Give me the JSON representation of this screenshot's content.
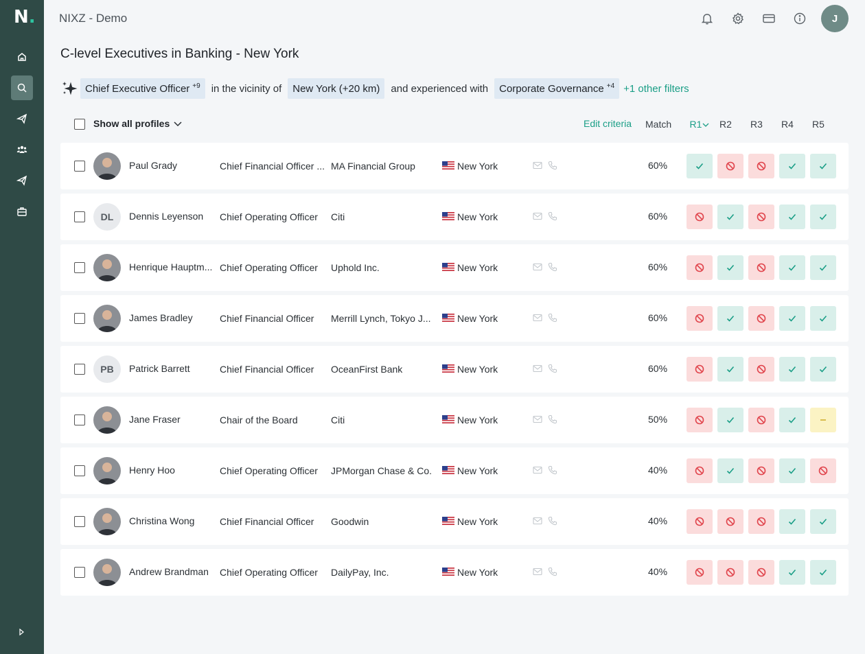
{
  "app": {
    "logo": "N",
    "logo_dot": ".",
    "title": "NIXZ - Demo",
    "user_initial": "J"
  },
  "colors": {
    "sidebar": "#2f4a46",
    "accent": "#1a9e86",
    "match_bg": "#d9efea",
    "mismatch_bg": "#fbdcdc",
    "partial_bg": "#fbf3c4"
  },
  "sidebar": {
    "items": [
      {
        "icon": "home-icon",
        "active": false
      },
      {
        "icon": "search-icon",
        "active": true
      },
      {
        "icon": "send-icon",
        "active": false
      },
      {
        "icon": "users-icon",
        "active": false
      },
      {
        "icon": "send-icon",
        "active": false
      },
      {
        "icon": "briefcase-icon",
        "active": false
      }
    ]
  },
  "topbar": {
    "icons": [
      "bell-icon",
      "gear-icon",
      "credit-card-icon",
      "info-icon"
    ]
  },
  "page_title": "C-level Executives in Banking - New York",
  "criteria": {
    "role_chip": "Chief Executive Officer",
    "role_more": "+9",
    "vicinity_text": "in the vicinity of",
    "location_chip": "New York (+20 km)",
    "experience_text": "and experienced with",
    "skill_chip": "Corporate Governance",
    "skill_more": "+4",
    "other_filters": "+1 other filters"
  },
  "list_header": {
    "show_all": "Show all profiles",
    "edit_criteria": "Edit criteria",
    "match": "Match",
    "requirements": [
      "R1",
      "R2",
      "R3",
      "R4",
      "R5"
    ]
  },
  "profiles": [
    {
      "name": "Paul Grady",
      "title": "Chief Financial Officer ...",
      "company": "MA Financial Group",
      "city": "New York",
      "match": "60%",
      "avatar": "photo",
      "initials": "",
      "r": [
        "ok",
        "no",
        "no",
        "ok",
        "ok"
      ]
    },
    {
      "name": "Dennis Leyenson",
      "title": "Chief Operating Officer",
      "company": "Citi",
      "city": "New York",
      "match": "60%",
      "avatar": "initials",
      "initials": "DL",
      "r": [
        "no",
        "ok",
        "no",
        "ok",
        "ok"
      ]
    },
    {
      "name": "Henrique Hauptm...",
      "title": "Chief Operating Officer",
      "company": "Uphold Inc.",
      "city": "New York",
      "match": "60%",
      "avatar": "photo",
      "initials": "",
      "r": [
        "no",
        "ok",
        "no",
        "ok",
        "ok"
      ]
    },
    {
      "name": "James Bradley",
      "title": "Chief Financial Officer",
      "company": "Merrill Lynch, Tokyo J...",
      "city": "New York",
      "match": "60%",
      "avatar": "photo",
      "initials": "",
      "r": [
        "no",
        "ok",
        "no",
        "ok",
        "ok"
      ]
    },
    {
      "name": "Patrick Barrett",
      "title": "Chief Financial Officer",
      "company": "OceanFirst Bank",
      "city": "New York",
      "match": "60%",
      "avatar": "initials",
      "initials": "PB",
      "r": [
        "no",
        "ok",
        "no",
        "ok",
        "ok"
      ]
    },
    {
      "name": "Jane Fraser",
      "title": "Chair of the Board",
      "company": "Citi",
      "city": "New York",
      "match": "50%",
      "avatar": "photo",
      "initials": "",
      "r": [
        "no",
        "ok",
        "no",
        "ok",
        "part"
      ]
    },
    {
      "name": "Henry Hoo",
      "title": "Chief Operating Officer",
      "company": "JPMorgan Chase & Co.",
      "city": "New York",
      "match": "40%",
      "avatar": "photo",
      "initials": "",
      "r": [
        "no",
        "ok",
        "no",
        "ok",
        "no"
      ]
    },
    {
      "name": "Christina Wong",
      "title": "Chief Financial Officer",
      "company": "Goodwin",
      "city": "New York",
      "match": "40%",
      "avatar": "photo",
      "initials": "",
      "r": [
        "no",
        "no",
        "no",
        "ok",
        "ok"
      ]
    },
    {
      "name": "Andrew Brandman",
      "title": "Chief Operating Officer",
      "company": "DailyPay, Inc.",
      "city": "New York",
      "match": "40%",
      "avatar": "photo",
      "initials": "",
      "r": [
        "no",
        "no",
        "no",
        "ok",
        "ok"
      ]
    }
  ]
}
